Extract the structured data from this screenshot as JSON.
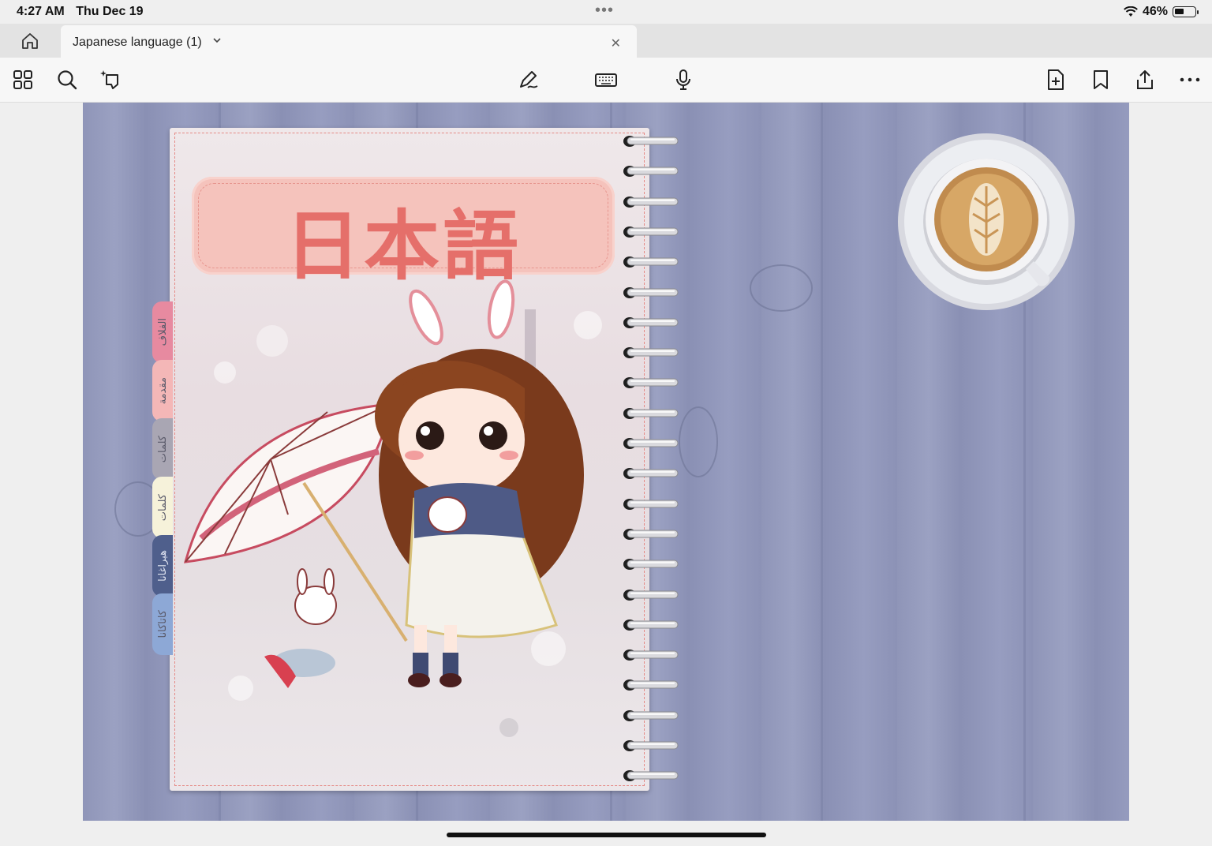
{
  "status": {
    "time": "4:27 AM",
    "date": "Thu Dec 19",
    "battery": "46%",
    "battery_level": 0.46
  },
  "tab": {
    "title": "Japanese language  (1)"
  },
  "toolbar": {
    "left_icons": [
      "grid-icon",
      "search-icon",
      "lasso-sparkle-icon"
    ],
    "center_icons": [
      "pen-icon",
      "keyboard-icon",
      "microphone-icon"
    ],
    "right_icons": [
      "add-page-icon",
      "bookmark-icon",
      "share-icon",
      "more-icon"
    ]
  },
  "notebook": {
    "title": "日本語",
    "side_tabs": [
      {
        "label": "الفلاف",
        "color": "#e78aa0"
      },
      {
        "label": "مقدمة",
        "color": "#f4b7b7"
      },
      {
        "label": "كلمات",
        "color": "#a9a6b3"
      },
      {
        "label": "كلمات",
        "color": "#f6f2da"
      },
      {
        "label": "هيراغانا",
        "color": "#4f5f8c"
      },
      {
        "label": "كاتاكانا",
        "color": "#8da8d6"
      }
    ],
    "ring_count": 22
  },
  "colors": {
    "wood": "#9399bb",
    "title": "#e56f6a",
    "pill": "#f5c3bc"
  }
}
